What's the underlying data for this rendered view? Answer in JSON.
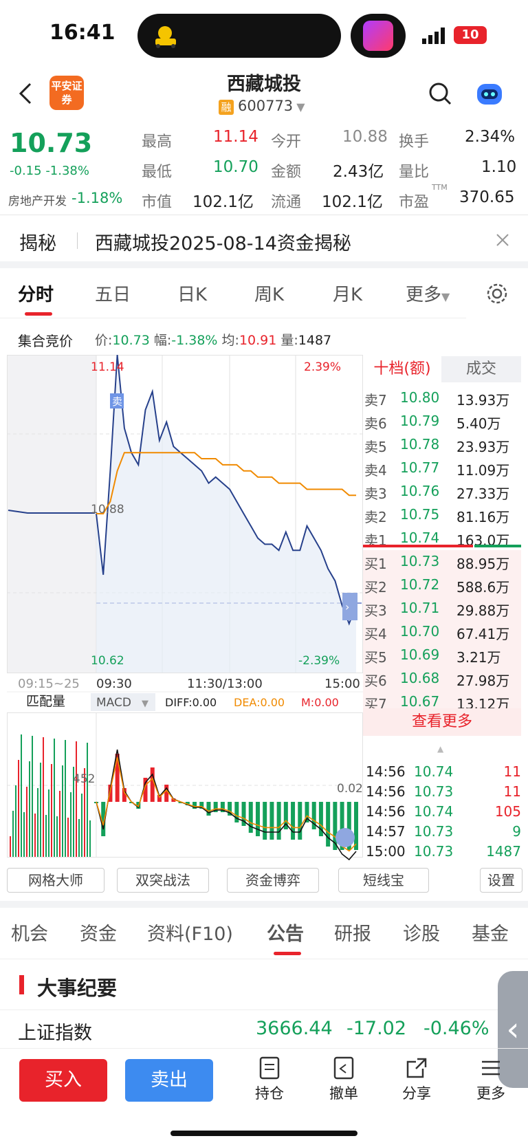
{
  "status": {
    "time": "16:41",
    "battery": "10"
  },
  "header": {
    "name": "西藏城投",
    "code": "600773",
    "rong": "融",
    "logo": "平安证券"
  },
  "quote": {
    "price": "10.73",
    "change": "-0.15",
    "change_pct": "-1.38%",
    "sector": "房地产开发",
    "sector_pct": "-1.18%",
    "high_l": "最高",
    "high": "11.14",
    "open_l": "今开",
    "open": "10.88",
    "turn_l": "换手",
    "turn": "2.34%",
    "low_l": "最低",
    "low": "10.70",
    "amt_l": "金额",
    "amt": "2.43亿",
    "vr_l": "量比",
    "vr": "1.10",
    "mcap_l": "市值",
    "mcap": "102.1亿",
    "float_l": "流通",
    "float": "102.1亿",
    "pe_l": "市盈",
    "pe_sup": "TTM",
    "pe": "370.65"
  },
  "banner": {
    "tag": "揭秘",
    "text": "西藏城投2025-08-14资金揭秘"
  },
  "ktabs": [
    "分时",
    "五日",
    "日K",
    "周K",
    "月K",
    "更多"
  ],
  "auction": {
    "label": "集合竞价",
    "price_l": "价:",
    "price": "10.73",
    "amp_l": "幅:",
    "amp": "-1.38%",
    "avg_l": "均:",
    "avg": "10.91",
    "vol_l": "量:",
    "vol": "1487"
  },
  "chart": {
    "top_price": "11.14",
    "top_pct": "2.39%",
    "mid_price": "10.88",
    "bot_price": "10.62",
    "bot_pct": "-2.39%",
    "t0": "09:15~25",
    "t1": "09:30",
    "t2": "11:30/13:00",
    "t3": "15:00",
    "sell_mark": "卖",
    "sub_label": "匹配量",
    "macd_label": "MACD",
    "diff": "DIFF:0.00",
    "dea": "DEA:0.00",
    "m": "M:0.00",
    "vol_mark": "452",
    "macd_mark": "0.02"
  },
  "chart_data": {
    "type": "line",
    "prev_close": 10.88,
    "ylim": [
      10.62,
      11.14
    ],
    "price": [
      10.88,
      10.78,
      10.95,
      11.14,
      11.02,
      10.98,
      10.96,
      11.05,
      11.08,
      11.0,
      11.03,
      10.99,
      10.98,
      10.97,
      10.96,
      10.95,
      10.93,
      10.94,
      10.93,
      10.92,
      10.9,
      10.88,
      10.86,
      10.84,
      10.83,
      10.83,
      10.82,
      10.85,
      10.82,
      10.82,
      10.86,
      10.84,
      10.82,
      10.79,
      10.77,
      10.73,
      10.7,
      10.73
    ],
    "avg": [
      10.88,
      10.88,
      10.9,
      10.95,
      10.98,
      10.98,
      10.98,
      10.98,
      10.98,
      10.98,
      10.98,
      10.98,
      10.98,
      10.98,
      10.98,
      10.97,
      10.97,
      10.97,
      10.96,
      10.96,
      10.96,
      10.95,
      10.95,
      10.94,
      10.94,
      10.94,
      10.93,
      10.93,
      10.93,
      10.93,
      10.92,
      10.92,
      10.92,
      10.92,
      10.92,
      10.92,
      10.91,
      10.91
    ]
  },
  "orderbook": {
    "tab1": "十档(额)",
    "tab2": "成交",
    "asks": [
      [
        "卖7",
        "10.80",
        "13.93万"
      ],
      [
        "卖6",
        "10.79",
        "5.40万"
      ],
      [
        "卖5",
        "10.78",
        "23.93万"
      ],
      [
        "卖4",
        "10.77",
        "11.09万"
      ],
      [
        "卖3",
        "10.76",
        "27.33万"
      ],
      [
        "卖2",
        "10.75",
        "81.16万"
      ],
      [
        "卖1",
        "10.74",
        "163.0万"
      ]
    ],
    "bids": [
      [
        "买1",
        "10.73",
        "88.95万"
      ],
      [
        "买2",
        "10.72",
        "588.6万"
      ],
      [
        "买3",
        "10.71",
        "29.88万"
      ],
      [
        "买4",
        "10.70",
        "67.41万"
      ],
      [
        "买5",
        "10.69",
        "3.21万"
      ],
      [
        "买6",
        "10.68",
        "27.98万"
      ],
      [
        "买7",
        "10.67",
        "13.12万"
      ]
    ],
    "more": "查看更多",
    "ticks": [
      [
        "14:56",
        "10.74",
        "11"
      ],
      [
        "14:56",
        "10.73",
        "11"
      ],
      [
        "14:56",
        "10.74",
        "105"
      ],
      [
        "14:57",
        "10.73",
        "9"
      ],
      [
        "15:00",
        "10.73",
        "1487"
      ]
    ]
  },
  "tools": [
    "网格大师",
    "双突战法",
    "资金博弈",
    "短线宝",
    "设置"
  ],
  "ntabs": [
    "机会",
    "资金",
    "资料(F10)",
    "公告",
    "研报",
    "诊股",
    "基金"
  ],
  "event": {
    "title": "大事纪要"
  },
  "index": {
    "name": "上证指数",
    "value": "3666.44",
    "chg": "-17.02",
    "pct": "-0.46%"
  },
  "bottom": {
    "buy": "买入",
    "sell": "卖出",
    "hold": "持仓",
    "cancel": "撤单",
    "share": "分享",
    "more": "更多"
  }
}
